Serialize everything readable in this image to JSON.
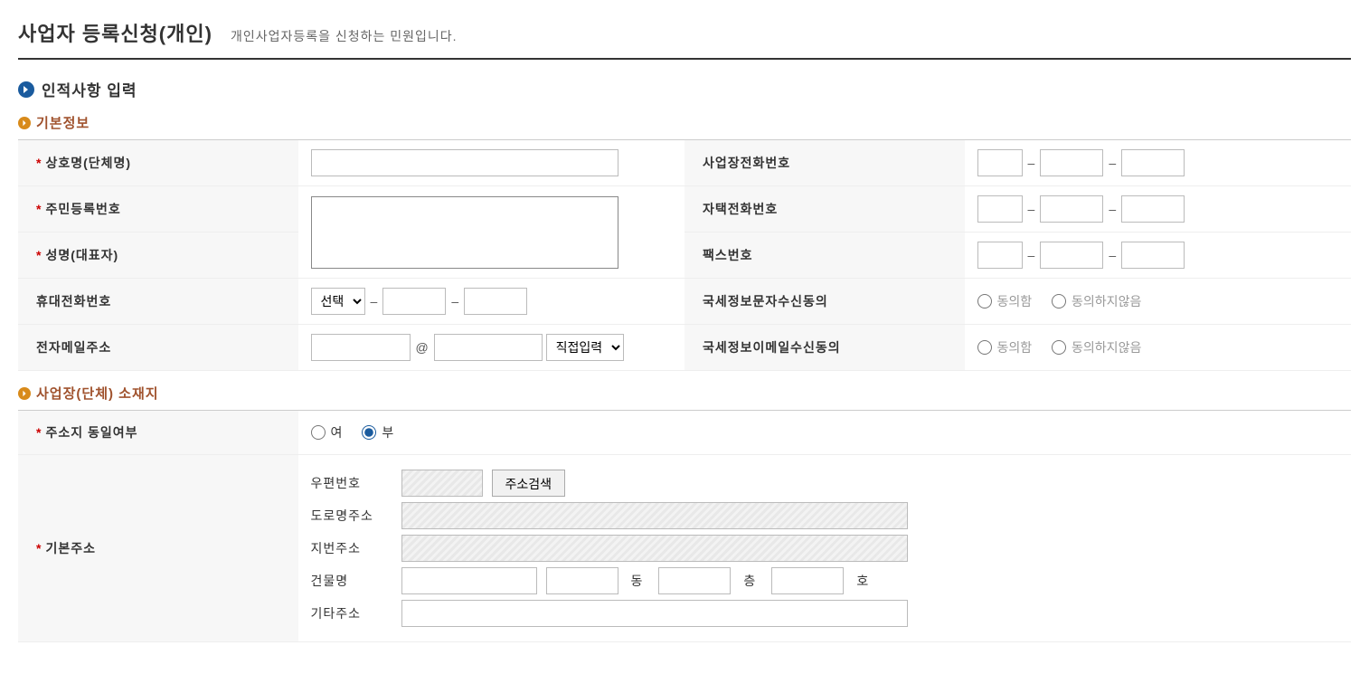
{
  "header": {
    "title": "사업자 등록신청(개인)",
    "subtitle": "개인사업자등록을 신청하는 민원입니다."
  },
  "section_personal": {
    "title": "인적사항 입력"
  },
  "basic_info": {
    "heading": "기본정보",
    "labels": {
      "company_name": "상호명(단체명)",
      "resident_no": "주민등록번호",
      "rep_name": "성명(대표자)",
      "mobile": "휴대전화번호",
      "email": "전자메일주소",
      "biz_phone": "사업장전화번호",
      "home_phone": "자택전화번호",
      "fax": "팩스번호",
      "sms_consent": "국세정보문자수신동의",
      "email_consent": "국세정보이메일수신동의"
    },
    "mobile_prefix_placeholder": "선택",
    "email_domain_placeholder": "직접입력",
    "consent_yes": "동의함",
    "consent_no": "동의하지않음"
  },
  "location": {
    "heading": "사업장(단체) 소재지",
    "labels": {
      "same_addr": "주소지 동일여부",
      "base_addr": "기본주소",
      "postal": "우편번호",
      "road_addr": "도로명주소",
      "jibun_addr": "지번주소",
      "building": "건물명",
      "dong": "동",
      "floor": "층",
      "ho": "호",
      "other_addr": "기타주소",
      "search_btn": "주소검색",
      "yes": "여",
      "no": "부"
    },
    "same_addr_value": "no"
  }
}
